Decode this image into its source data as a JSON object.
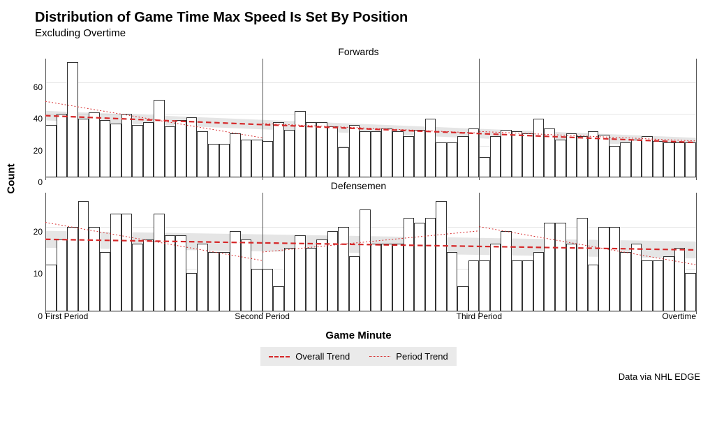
{
  "title": "Distribution of Game Time Max Speed Is Set By Position",
  "subtitle": "Excluding Overtime",
  "y_axis_title": "Count",
  "x_axis_title": "Game Minute",
  "caption": "Data via NHL EDGE",
  "legend": {
    "overall": "Overall Trend",
    "period": "Period Trend"
  },
  "x_ticks": [
    {
      "label": "First Period",
      "pct": 0
    },
    {
      "label": "Second Period",
      "pct": 33.33
    },
    {
      "label": "Third Period",
      "pct": 66.67
    },
    {
      "label": "Overtime",
      "pct": 100
    }
  ],
  "facets": [
    {
      "name": "Forwards",
      "y_max": 75,
      "y_ticks": [
        0,
        20,
        40,
        60
      ],
      "values": [
        33,
        40,
        73,
        37,
        41,
        36,
        34,
        40,
        33,
        35,
        49,
        32,
        36,
        38,
        29,
        21,
        21,
        28,
        24,
        24,
        23,
        35,
        30,
        42,
        35,
        35,
        32,
        19,
        33,
        29,
        29,
        31,
        29,
        26,
        30,
        37,
        22,
        22,
        26,
        31,
        13,
        26,
        30,
        29,
        28,
        37,
        31,
        24,
        28,
        26,
        29,
        27,
        20,
        22,
        24,
        26,
        23,
        22,
        22,
        22
      ],
      "trend_overall": {
        "start": 39,
        "end": 22
      },
      "trend_period": [
        {
          "x0": 0,
          "y0": 48,
          "x1": 20,
          "y1": 25
        },
        {
          "x0": 20,
          "y0": 34,
          "x1": 40,
          "y1": 28
        },
        {
          "x0": 40,
          "y0": 29,
          "x1": 60,
          "y1": 23
        }
      ],
      "band": {
        "start_hi": 42,
        "start_lo": 36,
        "end_hi": 25,
        "end_lo": 19
      }
    },
    {
      "name": "Defensemen",
      "y_max": 28,
      "y_ticks": [
        0,
        10,
        20
      ],
      "values": [
        11,
        17,
        20,
        26,
        20,
        14,
        23,
        23,
        16,
        17,
        23,
        18,
        18,
        9,
        16,
        14,
        14,
        19,
        17,
        10,
        10,
        6,
        15,
        18,
        15,
        17,
        19,
        20,
        13,
        24,
        16,
        16,
        16,
        22,
        21,
        22,
        26,
        14,
        6,
        12,
        12,
        16,
        19,
        12,
        12,
        14,
        21,
        21,
        16,
        22,
        11,
        20,
        20,
        14,
        16,
        12,
        12,
        13,
        15,
        9
      ],
      "trend_overall": {
        "start": 17,
        "end": 14.5
      },
      "trend_period": [
        {
          "x0": 0,
          "y0": 21,
          "x1": 20,
          "y1": 12
        },
        {
          "x0": 20,
          "y0": 14,
          "x1": 40,
          "y1": 19
        },
        {
          "x0": 40,
          "y0": 20,
          "x1": 60,
          "y1": 11
        }
      ],
      "band": {
        "start_hi": 19,
        "start_lo": 15,
        "end_hi": 16.5,
        "end_lo": 12.5
      }
    }
  ],
  "chart_data": [
    {
      "type": "bar",
      "facet": "Forwards",
      "title": "Distribution of Game Time Max Speed Is Set By Position — Forwards",
      "xlabel": "Game Minute",
      "ylabel": "Count",
      "x": [
        1,
        2,
        3,
        4,
        5,
        6,
        7,
        8,
        9,
        10,
        11,
        12,
        13,
        14,
        15,
        16,
        17,
        18,
        19,
        20,
        21,
        22,
        23,
        24,
        25,
        26,
        27,
        28,
        29,
        30,
        31,
        32,
        33,
        34,
        35,
        36,
        37,
        38,
        39,
        40,
        41,
        42,
        43,
        44,
        45,
        46,
        47,
        48,
        49,
        50,
        51,
        52,
        53,
        54,
        55,
        56,
        57,
        58,
        59,
        60
      ],
      "values": [
        33,
        40,
        73,
        37,
        41,
        36,
        34,
        40,
        33,
        35,
        49,
        32,
        36,
        38,
        29,
        21,
        21,
        28,
        24,
        24,
        23,
        35,
        30,
        42,
        35,
        35,
        32,
        19,
        33,
        29,
        29,
        31,
        29,
        26,
        30,
        37,
        22,
        22,
        26,
        31,
        13,
        26,
        30,
        29,
        28,
        37,
        31,
        24,
        28,
        26,
        29,
        27,
        20,
        22,
        24,
        26,
        23,
        22,
        22,
        22
      ],
      "ylim": [
        0,
        75
      ],
      "series_lines": [
        {
          "name": "Overall Trend",
          "type": "linear",
          "y_at_x1": 39,
          "y_at_x60": 22
        },
        {
          "name": "Period Trend (P1)",
          "x_range": [
            1,
            20
          ],
          "y_start": 48,
          "y_end": 25
        },
        {
          "name": "Period Trend (P2)",
          "x_range": [
            21,
            40
          ],
          "y_start": 34,
          "y_end": 28
        },
        {
          "name": "Period Trend (P3)",
          "x_range": [
            41,
            60
          ],
          "y_start": 29,
          "y_end": 23
        }
      ]
    },
    {
      "type": "bar",
      "facet": "Defensemen",
      "title": "Distribution of Game Time Max Speed Is Set By Position — Defensemen",
      "xlabel": "Game Minute",
      "ylabel": "Count",
      "x": [
        1,
        2,
        3,
        4,
        5,
        6,
        7,
        8,
        9,
        10,
        11,
        12,
        13,
        14,
        15,
        16,
        17,
        18,
        19,
        20,
        21,
        22,
        23,
        24,
        25,
        26,
        27,
        28,
        29,
        30,
        31,
        32,
        33,
        34,
        35,
        36,
        37,
        38,
        39,
        40,
        41,
        42,
        43,
        44,
        45,
        46,
        47,
        48,
        49,
        50,
        51,
        52,
        53,
        54,
        55,
        56,
        57,
        58,
        59,
        60
      ],
      "values": [
        11,
        17,
        20,
        26,
        20,
        14,
        23,
        23,
        16,
        17,
        23,
        18,
        18,
        9,
        16,
        14,
        14,
        19,
        17,
        10,
        10,
        6,
        15,
        18,
        15,
        17,
        19,
        20,
        13,
        24,
        16,
        16,
        16,
        22,
        21,
        22,
        26,
        14,
        6,
        12,
        12,
        16,
        19,
        12,
        12,
        14,
        21,
        21,
        16,
        22,
        11,
        20,
        20,
        14,
        16,
        12,
        12,
        13,
        15,
        9
      ],
      "ylim": [
        0,
        28
      ],
      "series_lines": [
        {
          "name": "Overall Trend",
          "type": "linear",
          "y_at_x1": 17,
          "y_at_x60": 14.5
        },
        {
          "name": "Period Trend (P1)",
          "x_range": [
            1,
            20
          ],
          "y_start": 21,
          "y_end": 12
        },
        {
          "name": "Period Trend (P2)",
          "x_range": [
            21,
            40
          ],
          "y_start": 14,
          "y_end": 19
        },
        {
          "name": "Period Trend (P3)",
          "x_range": [
            41,
            60
          ],
          "y_start": 20,
          "y_end": 11
        }
      ]
    }
  ]
}
